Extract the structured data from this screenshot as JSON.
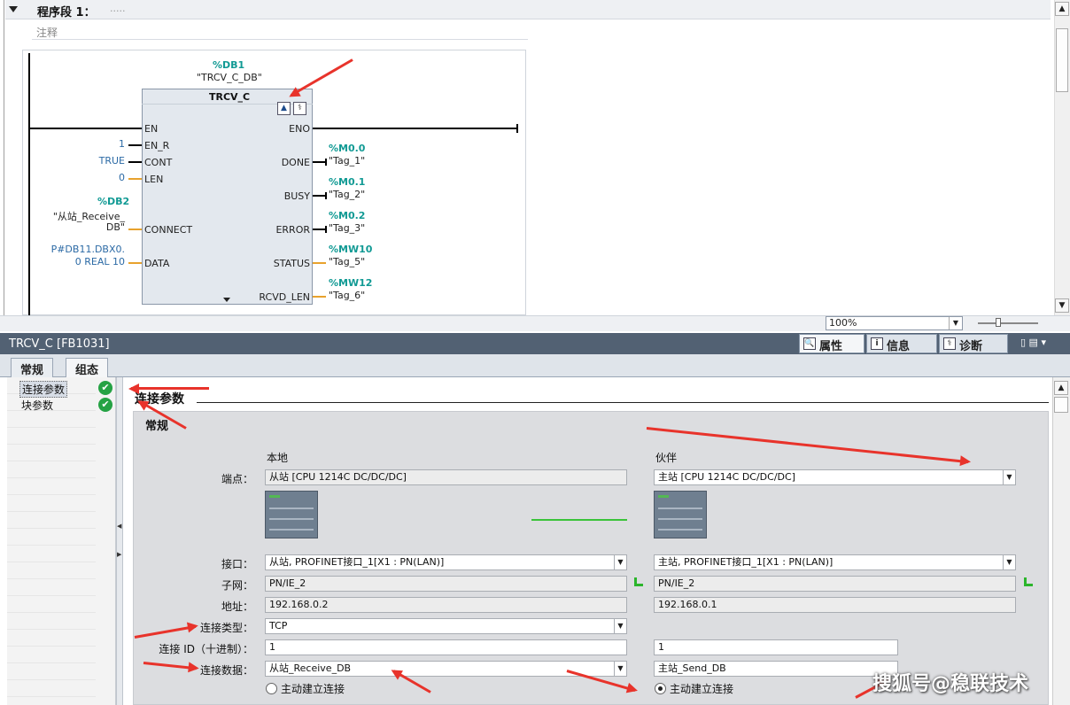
{
  "editor": {
    "network_title": "程序段 1：",
    "network_dots": ".....",
    "comment_label": "注释",
    "block": {
      "instance_addr": "%DB1",
      "instance_name": "\"TRCV_C_DB\"",
      "type": "TRCV_C",
      "icon1": "▲",
      "icon2": "⚕"
    },
    "inputs": [
      {
        "pin": "EN",
        "value": ""
      },
      {
        "pin": "EN_R",
        "value": "1"
      },
      {
        "pin": "CONT",
        "value": "TRUE"
      },
      {
        "pin": "LEN",
        "value": "0"
      },
      {
        "pin": "CONNECT",
        "addr": "%DB2",
        "value_line1": "\"从站_Receive_",
        "value_line2": "DB\""
      },
      {
        "pin": "DATA",
        "value_line1": "P#DB11.DBX0.",
        "value_line2": "0 REAL 10"
      }
    ],
    "outputs": [
      {
        "pin": "ENO",
        "addr": "",
        "tag": ""
      },
      {
        "pin": "DONE",
        "addr": "%M0.0",
        "tag": "\"Tag_1\""
      },
      {
        "pin": "BUSY",
        "addr": "%M0.1",
        "tag": "\"Tag_2\""
      },
      {
        "pin": "ERROR",
        "addr": "%M0.2",
        "tag": "\"Tag_3\""
      },
      {
        "pin": "STATUS",
        "addr": "%MW10",
        "tag": "\"Tag_5\""
      },
      {
        "pin": "RCVD_LEN",
        "addr": "%MW12",
        "tag": "\"Tag_6\""
      }
    ],
    "zoom": "100%"
  },
  "inspector": {
    "title": "TRCV_C [FB1031]",
    "right_tabs": [
      {
        "label": "属性",
        "icon": "properties-icon",
        "glyph": "🔍"
      },
      {
        "label": "信息",
        "icon": "info-icon",
        "glyph": "i"
      },
      {
        "label": "诊断",
        "icon": "diagnostics-icon",
        "glyph": "⚕"
      }
    ],
    "window_controls": "▯ ▤ ▾",
    "tabs": [
      "常规",
      "组态"
    ],
    "active_tab": "组态",
    "tree": [
      {
        "label": "连接参数",
        "status": "ok"
      },
      {
        "label": "块参数",
        "status": "ok"
      }
    ],
    "ok_glyph": "✔",
    "section_title": "连接参数",
    "group_title": "常规",
    "columns": {
      "local": "本地",
      "partner": "伙伴"
    },
    "rows": {
      "endpoint": {
        "label": "端点：",
        "local": "从站 [CPU 1214C DC/DC/DC]",
        "partner": "主站 [CPU 1214C DC/DC/DC]"
      },
      "interface": {
        "label": "接口：",
        "local": "从站, PROFINET接口_1[X1 : PN(LAN)]",
        "partner": "主站, PROFINET接口_1[X1 : PN(LAN)]"
      },
      "subnet": {
        "label": "子网：",
        "local": "PN/IE_2",
        "partner": "PN/IE_2"
      },
      "address": {
        "label": "地址：",
        "local": "192.168.0.2",
        "partner": "192.168.0.1"
      },
      "conn_type": {
        "label": "连接类型：",
        "local": "TCP"
      },
      "conn_id": {
        "label": "连接 ID（十进制）：",
        "local": "1",
        "partner": "1"
      },
      "conn_data": {
        "label": "连接数据：",
        "local": "从站_Receive_DB",
        "partner": "主站_Send_DB"
      },
      "active_conn": {
        "local": "主动建立连接",
        "partner": "主动建立连接",
        "local_checked": false,
        "partner_checked": true
      }
    },
    "drop_glyph": "▼"
  },
  "watermark": "搜狐号@稳联技术",
  "colors": {
    "accent_teal": "#119a94",
    "title_bar": "#526173",
    "ok_green": "#25a244",
    "annotation_red": "#e8332b"
  }
}
